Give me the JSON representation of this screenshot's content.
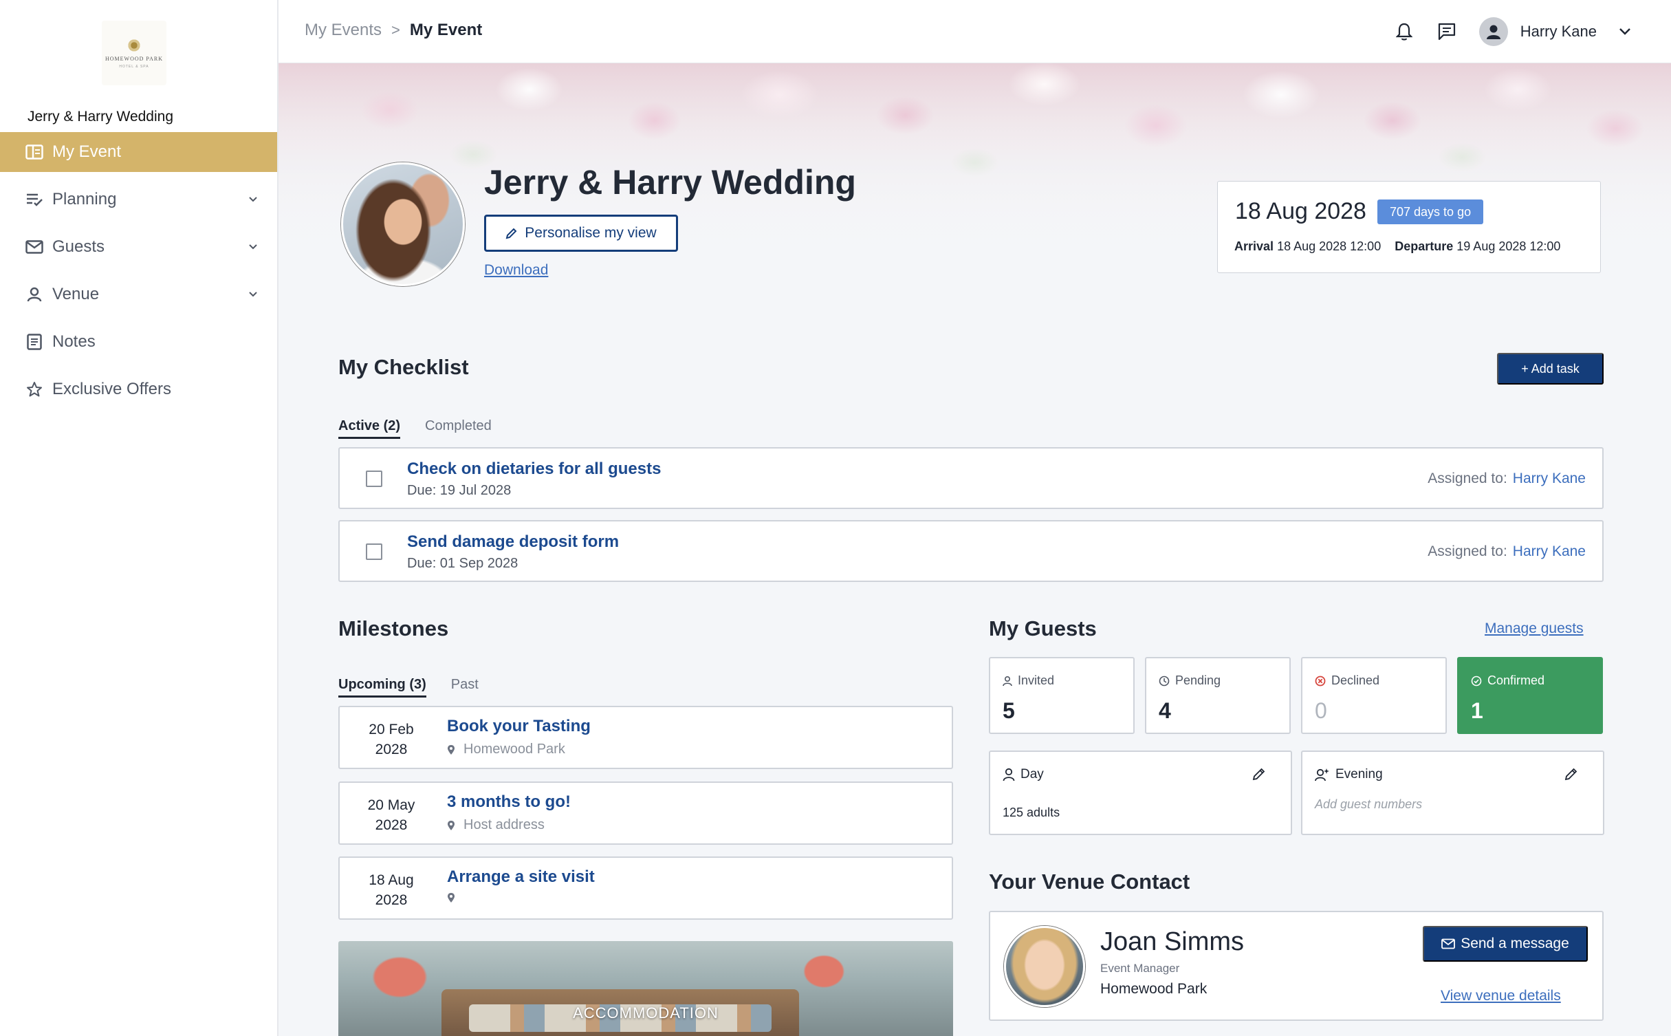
{
  "sidebar": {
    "logo": {
      "brand": "HOMEWOOD PARK",
      "tagline": "HOTEL & SPA"
    },
    "event_name": "Jerry & Harry Wedding",
    "items": [
      {
        "label": "My Event",
        "icon": "event-icon",
        "active": true
      },
      {
        "label": "Planning",
        "icon": "checklist-icon",
        "expandable": true
      },
      {
        "label": "Guests",
        "icon": "envelope-icon",
        "expandable": true
      },
      {
        "label": "Venue",
        "icon": "person-icon",
        "expandable": true
      },
      {
        "label": "Notes",
        "icon": "notes-icon"
      },
      {
        "label": "Exclusive Offers",
        "icon": "star-icon"
      }
    ],
    "active_color": "#d4b46a"
  },
  "header": {
    "breadcrumb": {
      "parent": "My Events",
      "separator": ">",
      "current": "My Event"
    },
    "user_name": "Harry Kane"
  },
  "hero": {
    "title": "Jerry & Harry Wedding",
    "personalise_label": "Personalise my view",
    "download_label": "Download",
    "date": "18 Aug 2028",
    "days_to_go": "707 days to go",
    "arrival_label": "Arrival",
    "arrival_value": "18 Aug 2028 12:00",
    "departure_label": "Departure",
    "departure_value": "19 Aug 2028 12:00"
  },
  "checklist": {
    "title": "My Checklist",
    "add_task_label": "+ Add task",
    "tabs": [
      {
        "label": "Active (2)",
        "active": true
      },
      {
        "label": "Completed",
        "active": false
      }
    ],
    "tasks": [
      {
        "title": "Check on dietaries for all guests",
        "due": "Due:  19 Jul 2028",
        "assigned_label": "Assigned to:",
        "assignee": "Harry Kane"
      },
      {
        "title": "Send damage deposit form",
        "due": "Due:  01 Sep 2028",
        "assigned_label": "Assigned to:",
        "assignee": "Harry Kane"
      }
    ]
  },
  "milestones": {
    "title": "Milestones",
    "tabs": [
      {
        "label": "Upcoming (3)",
        "active": true
      },
      {
        "label": "Past",
        "active": false
      }
    ],
    "items": [
      {
        "day_month": "20 Feb",
        "year": "2028",
        "title": "Book your Tasting",
        "location": "Homewood Park"
      },
      {
        "day_month": "20 May",
        "year": "2028",
        "title": "3 months to go!",
        "location": "Host address"
      },
      {
        "day_month": "18 Aug",
        "year": "2028",
        "title": "Arrange a site visit",
        "location": ""
      }
    ],
    "accommodation_label": "ACCOMMODATION"
  },
  "guests": {
    "title": "My Guests",
    "manage_label": "Manage guests",
    "stats": [
      {
        "label": "Invited",
        "value": "5",
        "icon": "person-outline-icon"
      },
      {
        "label": "Pending",
        "value": "4",
        "icon": "clock-icon"
      },
      {
        "label": "Declined",
        "value": "0",
        "icon": "x-circle-icon"
      },
      {
        "label": "Confirmed",
        "value": "1",
        "icon": "check-circle-icon"
      }
    ],
    "confirmed_color": "#3c9b5f",
    "declined_icon_color": "#d6453d",
    "sessions": [
      {
        "label": "Day",
        "value": "125 adults"
      },
      {
        "label": "Evening",
        "placeholder": "Add guest numbers"
      }
    ]
  },
  "venue_contact": {
    "title": "Your Venue Contact",
    "name": "Joan Simms",
    "role": "Event Manager",
    "venue": "Homewood Park",
    "message_label": "Send a message",
    "details_label": "View venue details"
  },
  "colors": {
    "primary": "#143d7a",
    "link": "#3c6ebd",
    "badge": "#5b8ddb"
  }
}
